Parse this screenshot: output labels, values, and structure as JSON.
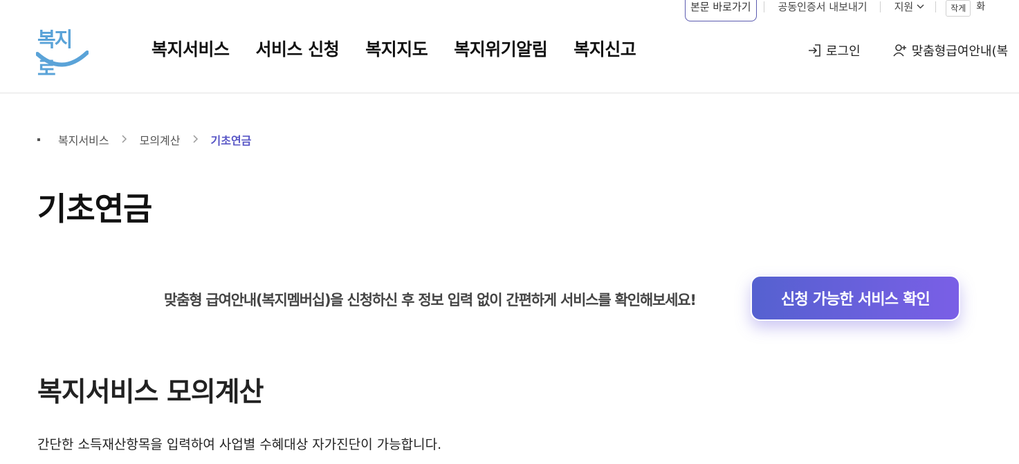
{
  "utility": {
    "skip_link": "본문 바로가기",
    "cert_export": "공동인증서 내보내기",
    "support": "지원",
    "font_small": "작게",
    "font_cut": "화"
  },
  "logo": {
    "text": "복지로"
  },
  "gnb": [
    {
      "label": "복지서비스"
    },
    {
      "label": "서비스 신청"
    },
    {
      "label": "복지지도"
    },
    {
      "label": "복지위기알림"
    },
    {
      "label": "복지신고"
    }
  ],
  "header_right": {
    "login": "로그인",
    "custom_benefit": "맞춤형급여안내(복"
  },
  "breadcrumb": [
    {
      "label": "복지서비스"
    },
    {
      "label": "모의계산"
    },
    {
      "label": "기초연금"
    }
  ],
  "page_title": "기초연금",
  "promo": {
    "text": "맞춤형 급여안내(복지멤버십)을 신청하신 후 정보 입력 없이 간편하게 서비스를 확인해보세요!",
    "button": "신청 가능한 서비스 확인"
  },
  "section": {
    "title": "복지서비스 모의계산",
    "description": "간단한 소득재산항목을 입력하여 사업별 수혜대상 자가진단이 가능합니다."
  },
  "colors": {
    "accent": "#5856c6",
    "button_gradient_start": "#5561d0",
    "button_gradient_end": "#7a5fe6",
    "logo": "#5aa3d8"
  },
  "icons": {
    "login": "login-arrow-icon",
    "custom_benefit": "user-plus-icon",
    "support_dropdown": "chevron-down-icon"
  }
}
